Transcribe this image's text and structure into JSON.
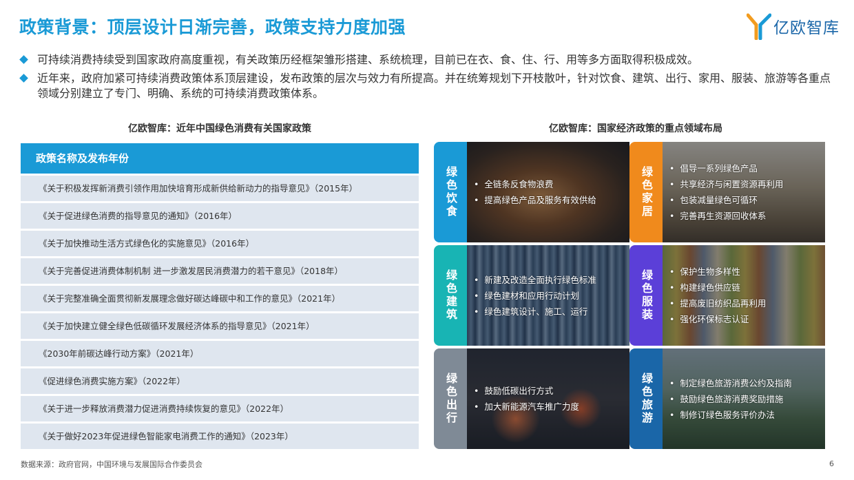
{
  "page_title": "政策背景：顶层设计日渐完善，政策支持力度加强",
  "logo": {
    "text": "亿欧智库",
    "colors": [
      "#f29c1f",
      "#1a9ad6",
      "#1a66a8"
    ]
  },
  "bullets": [
    "可持续消费持续受到国家政府高度重视，有关政策历经框架雏形搭建、系统梳理，目前已在衣、食、住、行、用等多方面取得积极成效。",
    "近年来，政府加紧可持续消费政策体系顶层建设，发布政策的层次与效力有所提高。并在统筹规划下开枝散叶，针对饮食、建筑、出行、家用、服装、旅游等各重点领域分别建立了专门、明确、系统的可持续消费政策体系。"
  ],
  "left": {
    "subtitle": "亿欧智库：近年中国绿色消费有关国家政策",
    "header": "政策名称及发布年份",
    "rows": [
      "《关于积极发挥新消费引领作用加快培育形成新供给新动力的指导意见》（2015年）",
      "《关于促进绿色消费的指导意见的通知》（2016年）",
      "《关于加快推动生活方式绿色化的实施意见》（2016年）",
      "《关于完善促进消费体制机制 进一步激发居民消费潜力的若干意见》（2018年）",
      "《关于完整准确全面贯彻新发展理念做好碳达峰碳中和工作的意见》（2021年）",
      "《关于加快建立健全绿色低碳循环发展经济体系的指导意见》（2021年）",
      "《2030年前碳达峰行动方案》（2021年）",
      "《促进绿色消费实施方案》（2022年）",
      "《关于进一步释放消费潜力促进消费持续恢复的意见》（2022年）",
      "《关于做好2023年促进绿色智能家电消费工作的通知》（2023年）"
    ]
  },
  "right": {
    "subtitle": "亿欧智库：国家经济政策的重点领域布局",
    "cells": [
      {
        "label": "绿色饮食",
        "color": "#1a9ad6",
        "items": [
          "全链条反食物浪费",
          "提高绿色产品及服务有效供给"
        ]
      },
      {
        "label": "绿色家居",
        "color": "#f08a1c",
        "items": [
          "倡导一系列绿色产品",
          "共享经济与闲置资源再利用",
          "包装减量绿色可循环",
          "完善再生资源回收体系"
        ]
      },
      {
        "label": "绿色建筑",
        "color": "#18b4b4",
        "items": [
          "新建及改造全面执行绿色标准",
          "绿色建材和应用行动计划",
          "绿色建筑设计、施工、运行"
        ]
      },
      {
        "label": "绿色服装",
        "color": "#5b3fd8",
        "items": [
          "保护生物多样性",
          "构建绿色供应链",
          "提高废旧纺织品再利用",
          "强化环保标志认证"
        ]
      },
      {
        "label": "绿色出行",
        "color": "#7f8a96",
        "items": [
          "鼓励低碳出行方式",
          "加大新能源汽车推广力度"
        ]
      },
      {
        "label": "绿色旅游",
        "color": "#1a66a8",
        "items": [
          "制定绿色旅游消费公约及指南",
          "鼓励绿色旅游消费奖励措施",
          "制修订绿色服务评价办法"
        ]
      }
    ]
  },
  "footer": {
    "source": "数据来源：政府官网，中国环境与发展国际合作委员会",
    "page": "6"
  }
}
